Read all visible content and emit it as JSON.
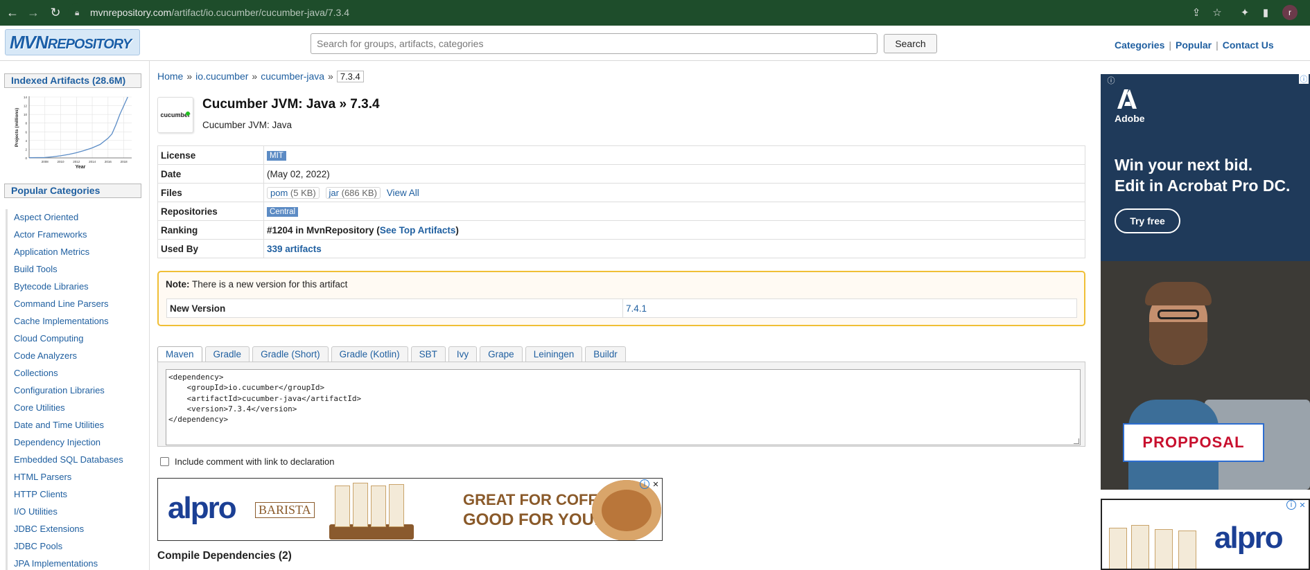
{
  "browser": {
    "url_host": "mvnrepository.com",
    "url_path": "/artifact/io.cucumber/cucumber-java/7.3.4",
    "profile_initial": "r"
  },
  "header": {
    "logo_text_main": "MVN",
    "logo_text_rest": "REPOSITORY",
    "search_placeholder": "Search for groups, artifacts, categories",
    "search_button": "Search",
    "links": [
      "Categories",
      "Popular",
      "Contact Us"
    ],
    "link_separator": "|"
  },
  "sidebar": {
    "indexed_title": "Indexed Artifacts (28.6M)",
    "popular_title": "Popular Categories",
    "categories": [
      "Aspect Oriented",
      "Actor Frameworks",
      "Application Metrics",
      "Build Tools",
      "Bytecode Libraries",
      "Command Line Parsers",
      "Cache Implementations",
      "Cloud Computing",
      "Code Analyzers",
      "Collections",
      "Configuration Libraries",
      "Core Utilities",
      "Date and Time Utilities",
      "Dependency Injection",
      "Embedded SQL Databases",
      "HTML Parsers",
      "HTTP Clients",
      "I/O Utilities",
      "JDBC Extensions",
      "JDBC Pools",
      "JPA Implementations"
    ]
  },
  "chart_data": {
    "type": "line",
    "title": "",
    "xlabel": "Year",
    "ylabel": "Projects (millions)",
    "x_ticks": [
      "2008",
      "2010",
      "2012",
      "2014",
      "2016",
      "2018"
    ],
    "y_ticks": [
      "0",
      "2",
      "4",
      "6",
      "8",
      "10",
      "12",
      "14"
    ],
    "xlim": [
      2006,
      2019
    ],
    "ylim": [
      0,
      14
    ],
    "series": [
      {
        "x": [
          2006,
          2008,
          2009,
          2010,
          2011,
          2012,
          2013,
          2014,
          2015,
          2016,
          2016.5,
          2017,
          2017.5,
          2018,
          2018.5
        ],
        "y": [
          0.05,
          0.1,
          0.25,
          0.5,
          0.8,
          1.2,
          1.7,
          2.3,
          3.1,
          4.5,
          5.5,
          7.6,
          10.0,
          12.0,
          14.0
        ]
      }
    ],
    "grid": true
  },
  "breadcrumb": {
    "items": [
      "Home",
      "io.cucumber",
      "cucumber-java"
    ],
    "separator": "»",
    "current": "7.3.4"
  },
  "artifact": {
    "logo_text": "cucumber",
    "title": "Cucumber JVM: Java » 7.3.4",
    "subtitle": "Cucumber JVM: Java"
  },
  "info": {
    "license_label": "License",
    "license": "MIT",
    "date_label": "Date",
    "date": "(May 02, 2022)",
    "files_label": "Files",
    "files": [
      {
        "name": "pom",
        "size": "(5 KB)"
      },
      {
        "name": "jar",
        "size": "(686 KB)"
      }
    ],
    "view_all": "View All",
    "repositories_label": "Repositories",
    "repository": "Central",
    "ranking_label": "Ranking",
    "ranking_text": "#1204 in MvnRepository (",
    "ranking_link": "See Top Artifacts",
    "ranking_close": ")",
    "used_by_label": "Used By",
    "used_by": "339 artifacts"
  },
  "note": {
    "prefix": "Note:",
    "text": " There is a new version for this artifact",
    "new_version_label": "New Version",
    "new_version": "7.4.1"
  },
  "tabs": [
    "Maven",
    "Gradle",
    "Gradle (Short)",
    "Gradle (Kotlin)",
    "SBT",
    "Ivy",
    "Grape",
    "Leiningen",
    "Buildr"
  ],
  "code": "<dependency>\n    <groupId>io.cucumber</groupId>\n    <artifactId>cucumber-java</artifactId>\n    <version>7.3.4</version>\n</dependency>",
  "include_comment_label": "Include comment with link to declaration",
  "ad_banner": {
    "brand": "alpro",
    "sub_brand": "BARISTA",
    "line1": "GREAT FOR COFFEE",
    "line2": "GOOD FOR YOU!"
  },
  "compile_dependencies": "Compile Dependencies (2)",
  "ad_right": {
    "brand": "Adobe",
    "headline1": "Win your next bid.",
    "headline2": "Edit in Acrobat Pro DC.",
    "cta": "Try free",
    "overlay_text": "PROPPOSAL",
    "bottom_brand": "alpro"
  },
  "colors": {
    "chrome": "#1e4d2b",
    "link": "#1f5fa0",
    "note_border": "#f0bf35",
    "badge": "#5c8bc4",
    "ad_bg": "#1f3a5a"
  }
}
